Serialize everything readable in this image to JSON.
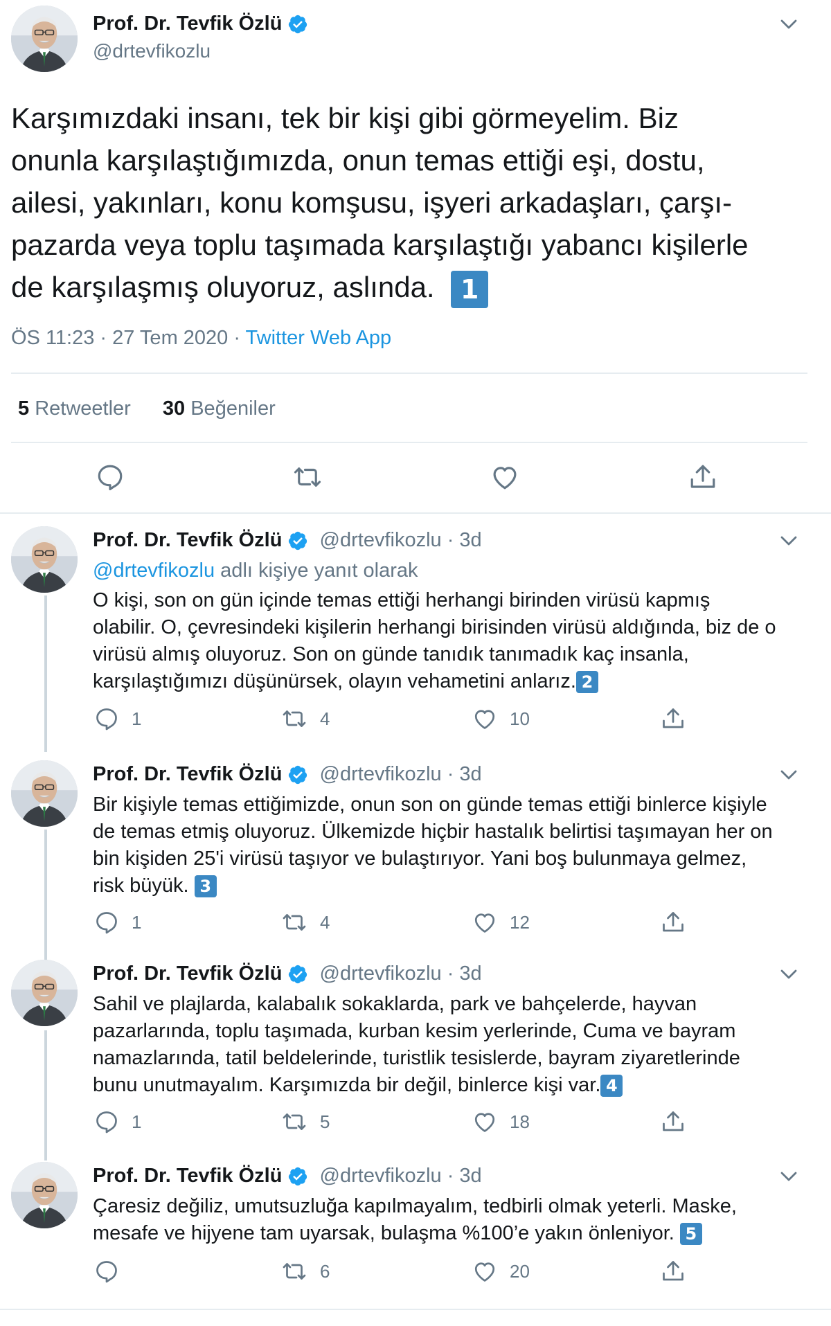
{
  "main_tweet": {
    "author_name": "Prof. Dr. Tevfik Özlü",
    "handle": "@drtevfikozlu",
    "text_lines": [
      "Karşımızdaki insanı, tek bir kişi gibi görmeyelim. Biz",
      "onunla karşılaştığımızda, onun temas ettiği eşi, dostu,",
      "ailesi, yakınları, konu komşusu, işyeri arkadaşları, çarşı-",
      "pazarda veya toplu taşımada karşılaştığı yabancı kişilerle",
      "de karşılaşmış oluyoruz, aslında."
    ],
    "badge": "1",
    "time": "ÖS 11:23 · 27 Tem 2020 · ",
    "source": "Twitter Web App",
    "retweets_count": "5",
    "retweets_label": "Retweetler",
    "likes_count": "30",
    "likes_label": "Beğeniler"
  },
  "replies": [
    {
      "author_name": "Prof. Dr. Tevfik Özlü",
      "handle": "@drtevfikozlu",
      "time": "· 3d",
      "reply_to_handle": "@drtevfikozlu",
      "reply_to_suffix": " adlı kişiye yanıt olarak",
      "text_lines": [
        "O kişi, son on gün içinde temas ettiği herhangi birinden virüsü kapmış",
        "olabilir. O, çevresindeki kişilerin herhangi birisinden virüsü aldığında, biz de o",
        "virüsü almış oluyoruz. Son on günde tanıdık tanımadık kaç insanla,",
        "karşılaştığımızı düşünürsek, olayın vehametini anlarız."
      ],
      "badge": "2",
      "replies": "1",
      "retweets": "4",
      "likes": "10"
    },
    {
      "author_name": "Prof. Dr. Tevfik Özlü",
      "handle": "@drtevfikozlu",
      "time": "· 3d",
      "text_lines": [
        "Bir kişiyle temas ettiğimizde, onun son on günde temas ettiği binlerce kişiyle",
        "de temas etmiş oluyoruz. Ülkemizde hiçbir hastalık belirtisi taşımayan her on",
        "bin kişiden 25'i virüsü taşıyor ve bulaştırıyor. Yani boş bulunmaya gelmez,",
        "risk büyük. "
      ],
      "badge": "3",
      "replies": "1",
      "retweets": "4",
      "likes": "12"
    },
    {
      "author_name": "Prof. Dr. Tevfik Özlü",
      "handle": "@drtevfikozlu",
      "time": "· 3d",
      "text_lines": [
        "Sahil ve plajlarda, kalabalık sokaklarda, park ve bahçelerde, hayvan",
        "pazarlarında, toplu taşımada, kurban kesim yerlerinde, Cuma ve bayram",
        "namazlarında, tatil beldelerinde, turistlik tesislerde, bayram ziyaretlerinde",
        "bunu unutmayalım. Karşımızda bir değil, binlerce kişi var."
      ],
      "badge": "4",
      "replies": "1",
      "retweets": "5",
      "likes": "18"
    },
    {
      "author_name": "Prof. Dr. Tevfik Özlü",
      "handle": "@drtevfikozlu",
      "time": "· 3d",
      "text_lines": [
        "Çaresiz değiliz, umutsuzluğa kapılmayalım, tedbirli olmak yeterli. Maske,",
        "mesafe ve hijyene tam uyarsak, bulaşma %100’e yakın önleniyor. "
      ],
      "badge": "5",
      "replies": "",
      "retweets": "6",
      "likes": "20"
    }
  ],
  "icons": {
    "reply": "reply-icon",
    "retweet": "retweet-icon",
    "like": "heart-icon",
    "share": "share-icon",
    "menu": "chevron-down-icon",
    "verified": "verified-badge-icon"
  },
  "colors": {
    "accent": "#1b95e0",
    "verified": "#1da1f2",
    "muted": "#657786",
    "keycap": "#3b88c3"
  }
}
